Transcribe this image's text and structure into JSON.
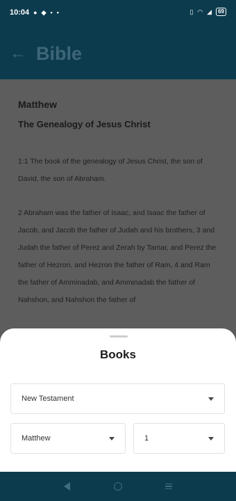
{
  "status_bar": {
    "time": "10:04",
    "left_icons": [
      "message-icon",
      "message-icon",
      "notification-icon"
    ],
    "right_icons": [
      "vibrate-icon",
      "wifi-icon",
      "signal-icon"
    ],
    "battery": "69"
  },
  "app_bar": {
    "title": "Bible",
    "back_icon": "arrow-left-icon"
  },
  "reader": {
    "book": "Matthew",
    "heading": "The Genealogy of Jesus Christ",
    "paragraphs": [
      "1:1 The book of the genealogy of Jesus Christ, the son of David, the son of Abraham.",
      "2 Abraham was the father of Isaac, and Isaac the father of Jacob, and Jacob the father of Judah and his brothers, 3 and Judah the father of Perez and Zerah by Tamar, and Perez the father of Hezron, and Hezron the father of Ram, 4 and Ram the father of Amminadab, and Amminadab the father of Nahshon, and Nahshon the father of"
    ]
  },
  "books_sheet": {
    "title": "Books",
    "testament_select": "New Testament",
    "book_select": "Matthew",
    "chapter_select": "1"
  },
  "nav_bar": {
    "back": "triangle-back-icon",
    "home": "circle-home-icon",
    "recents": "menu-recents-icon"
  },
  "colors": {
    "app_bar": "#0d3b4e",
    "scrim_content": "#5d5d5d",
    "sheet": "#ffffff"
  }
}
